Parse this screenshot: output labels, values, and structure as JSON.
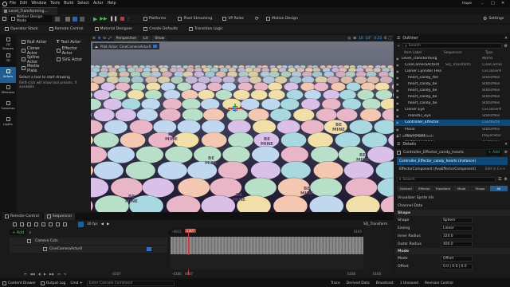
{
  "window": {
    "menu": [
      "File",
      "Edit",
      "Window",
      "Tools",
      "Build",
      "Select",
      "Actor",
      "Help"
    ],
    "user": "Hope",
    "level_tab": "Level_Transforming..."
  },
  "main_toolbar": {
    "mode": "Motion Design Mode",
    "platforms": "Platforms",
    "pixel_streaming": "Pixel Streaming",
    "vp_roles": "VP Roles",
    "motion_design": "Motion Design",
    "settings": "Settings"
  },
  "motion_toolbar": {
    "items": [
      "Operator Stack",
      "Remote Control",
      "Material Designer",
      "Create Defaults",
      "Transition Logic"
    ]
  },
  "tools": {
    "categories": [
      "2D Shapes",
      "3D",
      "Actors",
      "Effectors",
      "Cameras",
      "Lights"
    ],
    "buttons": [
      "Null Actor",
      "Text Actor",
      "Cloner Actor",
      "Effector Actor",
      "Spline Actor",
      "SVG Actor",
      "Media Plate"
    ],
    "hint1": "Select a tool to start drawing",
    "hint2": "Shift-click will show tool presets, if available"
  },
  "viewport": {
    "view_mode": "Perspective",
    "lit": "Lit",
    "show": "Show",
    "pilot": "Pilot Actor: CineCameraActor0",
    "snap_value": "10",
    "rot_value": "10°",
    "scale_value": "0.25",
    "cam_speed": "4",
    "candy_texts": [
      "BE MINE",
      "BE MINE",
      "BE MINE",
      "BE MINE",
      "BE MINE",
      "BE MINE",
      "BE MINE",
      "BE MINE"
    ]
  },
  "outliner": {
    "title": "Outliner",
    "search_placeholder": "Search",
    "col_label": "Item Label",
    "col_type": "Type",
    "col_seq": "Sequencer",
    "rows": [
      {
        "label": "Level_Transforming",
        "type": "World",
        "extra": ""
      },
      {
        "label": "CineCameraActor0",
        "type": "CineCamer",
        "extra": "SQ_Transform"
      },
      {
        "label": "Cloner Cylinder Hea",
        "type": "CEClonerA",
        "extra": ""
      },
      {
        "label": "heart_candy_fee",
        "type": "StaticMes",
        "extra": ""
      },
      {
        "label": "heart_candy_be",
        "type": "StaticMes",
        "extra": ""
      },
      {
        "label": "heart_candy_be",
        "type": "StaticMes",
        "extra": ""
      },
      {
        "label": "heart_candy_be",
        "type": "StaticMes",
        "extra": ""
      },
      {
        "label": "heart_candy_be",
        "type": "StaticMes",
        "extra": ""
      },
      {
        "label": "Cloner Eye",
        "type": "CEClonerA",
        "extra": ""
      },
      {
        "label": "realistic_eye",
        "type": "StaticMes",
        "extra": ""
      },
      {
        "label": "Controller_Effector",
        "type": "CEEffecto",
        "extra": ""
      },
      {
        "label": "Plane",
        "type": "StaticMes",
        "extra": ""
      },
      {
        "label": "PlayerStart",
        "type": "PlayerStar",
        "extra": ""
      },
      {
        "label": "PostProcessVolu",
        "type": "PostProce",
        "extra": ""
      }
    ],
    "count": "17 actors (1 selected)"
  },
  "details": {
    "title": "Details",
    "actor_name": "Controller_Effector_candy_hearts",
    "add_label": "+ Add",
    "instance": "Controller_Effector_candy_hearts (Instance)",
    "component": "EffectorComponent (AvaEffectorComponent)",
    "component_edit": "Edit in C++",
    "search_placeholder": "Search",
    "tabs": [
      "General",
      "Effector",
      "Transform",
      "Mode",
      "Shape",
      "All"
    ],
    "props": [
      {
        "label": "Visualizer Sprite Vis",
        "value": ""
      },
      {
        "label": "Channel Data",
        "value": ""
      },
      {
        "label": "Shape",
        "value": "",
        "section": true
      },
      {
        "label": "Shape",
        "value": "Sphere"
      },
      {
        "label": "Easing",
        "value": "Linear"
      },
      {
        "label": "Inner Radius",
        "value": "320.0"
      },
      {
        "label": "Outer Radius",
        "value": "400.0"
      },
      {
        "label": "Mode",
        "value": "",
        "section": true
      },
      {
        "label": "Mode",
        "value": "Offset"
      },
      {
        "label": "Offset",
        "value": "0.0 | 0.0 | 0.0"
      }
    ]
  },
  "bottom_tabs": [
    "Remote Control",
    "Sequencer"
  ],
  "sequencer": {
    "add_label": "+ Add",
    "fps": "30 fps",
    "sequence_name": "SQ_Transform",
    "time_value": "0007",
    "tracks": [
      "Camera Cuts",
      "CineCameraActor0"
    ],
    "ruler_start": "-0015",
    "ruler_end": "0165",
    "playhead": "0007",
    "footer_values": [
      "-0107",
      "-0180",
      "0007",
      "0180",
      "0160"
    ]
  },
  "status_bar": {
    "items": [
      "Content Drawer",
      "Output Log",
      "Cmd"
    ],
    "cmd_placeholder": "Enter Console Command",
    "right_items": [
      "Trace",
      "Derived Data",
      "Broadcast",
      "1 Unsaved",
      "Revision Control"
    ]
  }
}
